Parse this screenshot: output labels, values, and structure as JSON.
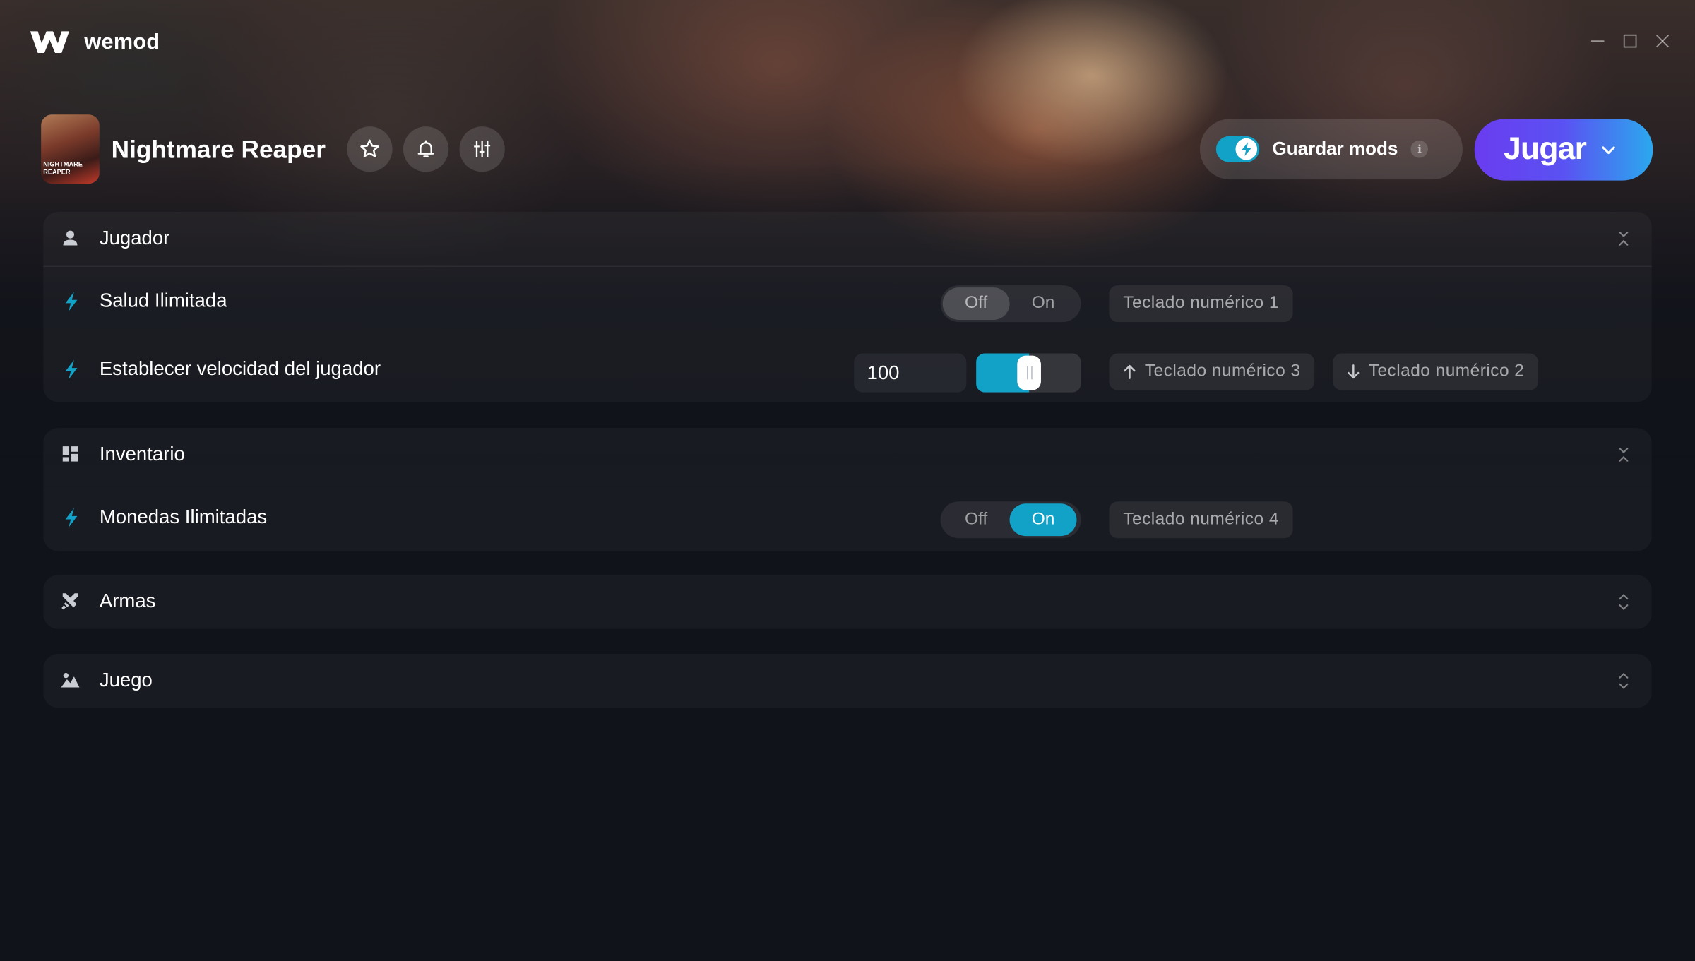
{
  "app": {
    "name": "wemod",
    "colors": {
      "accent": "#13a2c7",
      "play_gradient_start": "#6a3cf0",
      "play_gradient_end": "#2ba8ee",
      "background": "#11131a"
    }
  },
  "window_controls": {
    "minimize_icon": "minimize-icon",
    "maximize_icon": "maximize-icon",
    "close_icon": "close-icon"
  },
  "game": {
    "title": "Nightmare Reaper",
    "thumbnail_text": "NIGHTMARE REAPER",
    "actions": [
      "star-icon",
      "bell-icon",
      "sliders-icon"
    ]
  },
  "save_mods": {
    "label": "Guardar mods",
    "enabled": true,
    "info": "i"
  },
  "play": {
    "label": "Jugar"
  },
  "sections": {
    "player": {
      "title": "Jugador",
      "icon": "user-icon",
      "expanded": true,
      "mods": {
        "infinite_health": {
          "label": "Salud Ilimitada",
          "state": "Off",
          "off_label": "Off",
          "on_label": "On",
          "hotkey": "Teclado numérico 1"
        },
        "player_speed": {
          "label": "Establecer velocidad del jugador",
          "value": "100",
          "slider_fraction": 0.5,
          "hotkey_up": "Teclado numérico 3",
          "hotkey_down": "Teclado numérico 2"
        }
      }
    },
    "inventory": {
      "title": "Inventario",
      "icon": "grid-icon",
      "expanded": true,
      "mods": {
        "infinite_coins": {
          "label": "Monedas Ilimitadas",
          "state": "On",
          "off_label": "Off",
          "on_label": "On",
          "hotkey": "Teclado numérico 4"
        }
      }
    },
    "weapons": {
      "title": "Armas",
      "icon": "crossed-swords-icon",
      "expanded": false
    },
    "game": {
      "title": "Juego",
      "icon": "landscape-icon",
      "expanded": false
    }
  }
}
